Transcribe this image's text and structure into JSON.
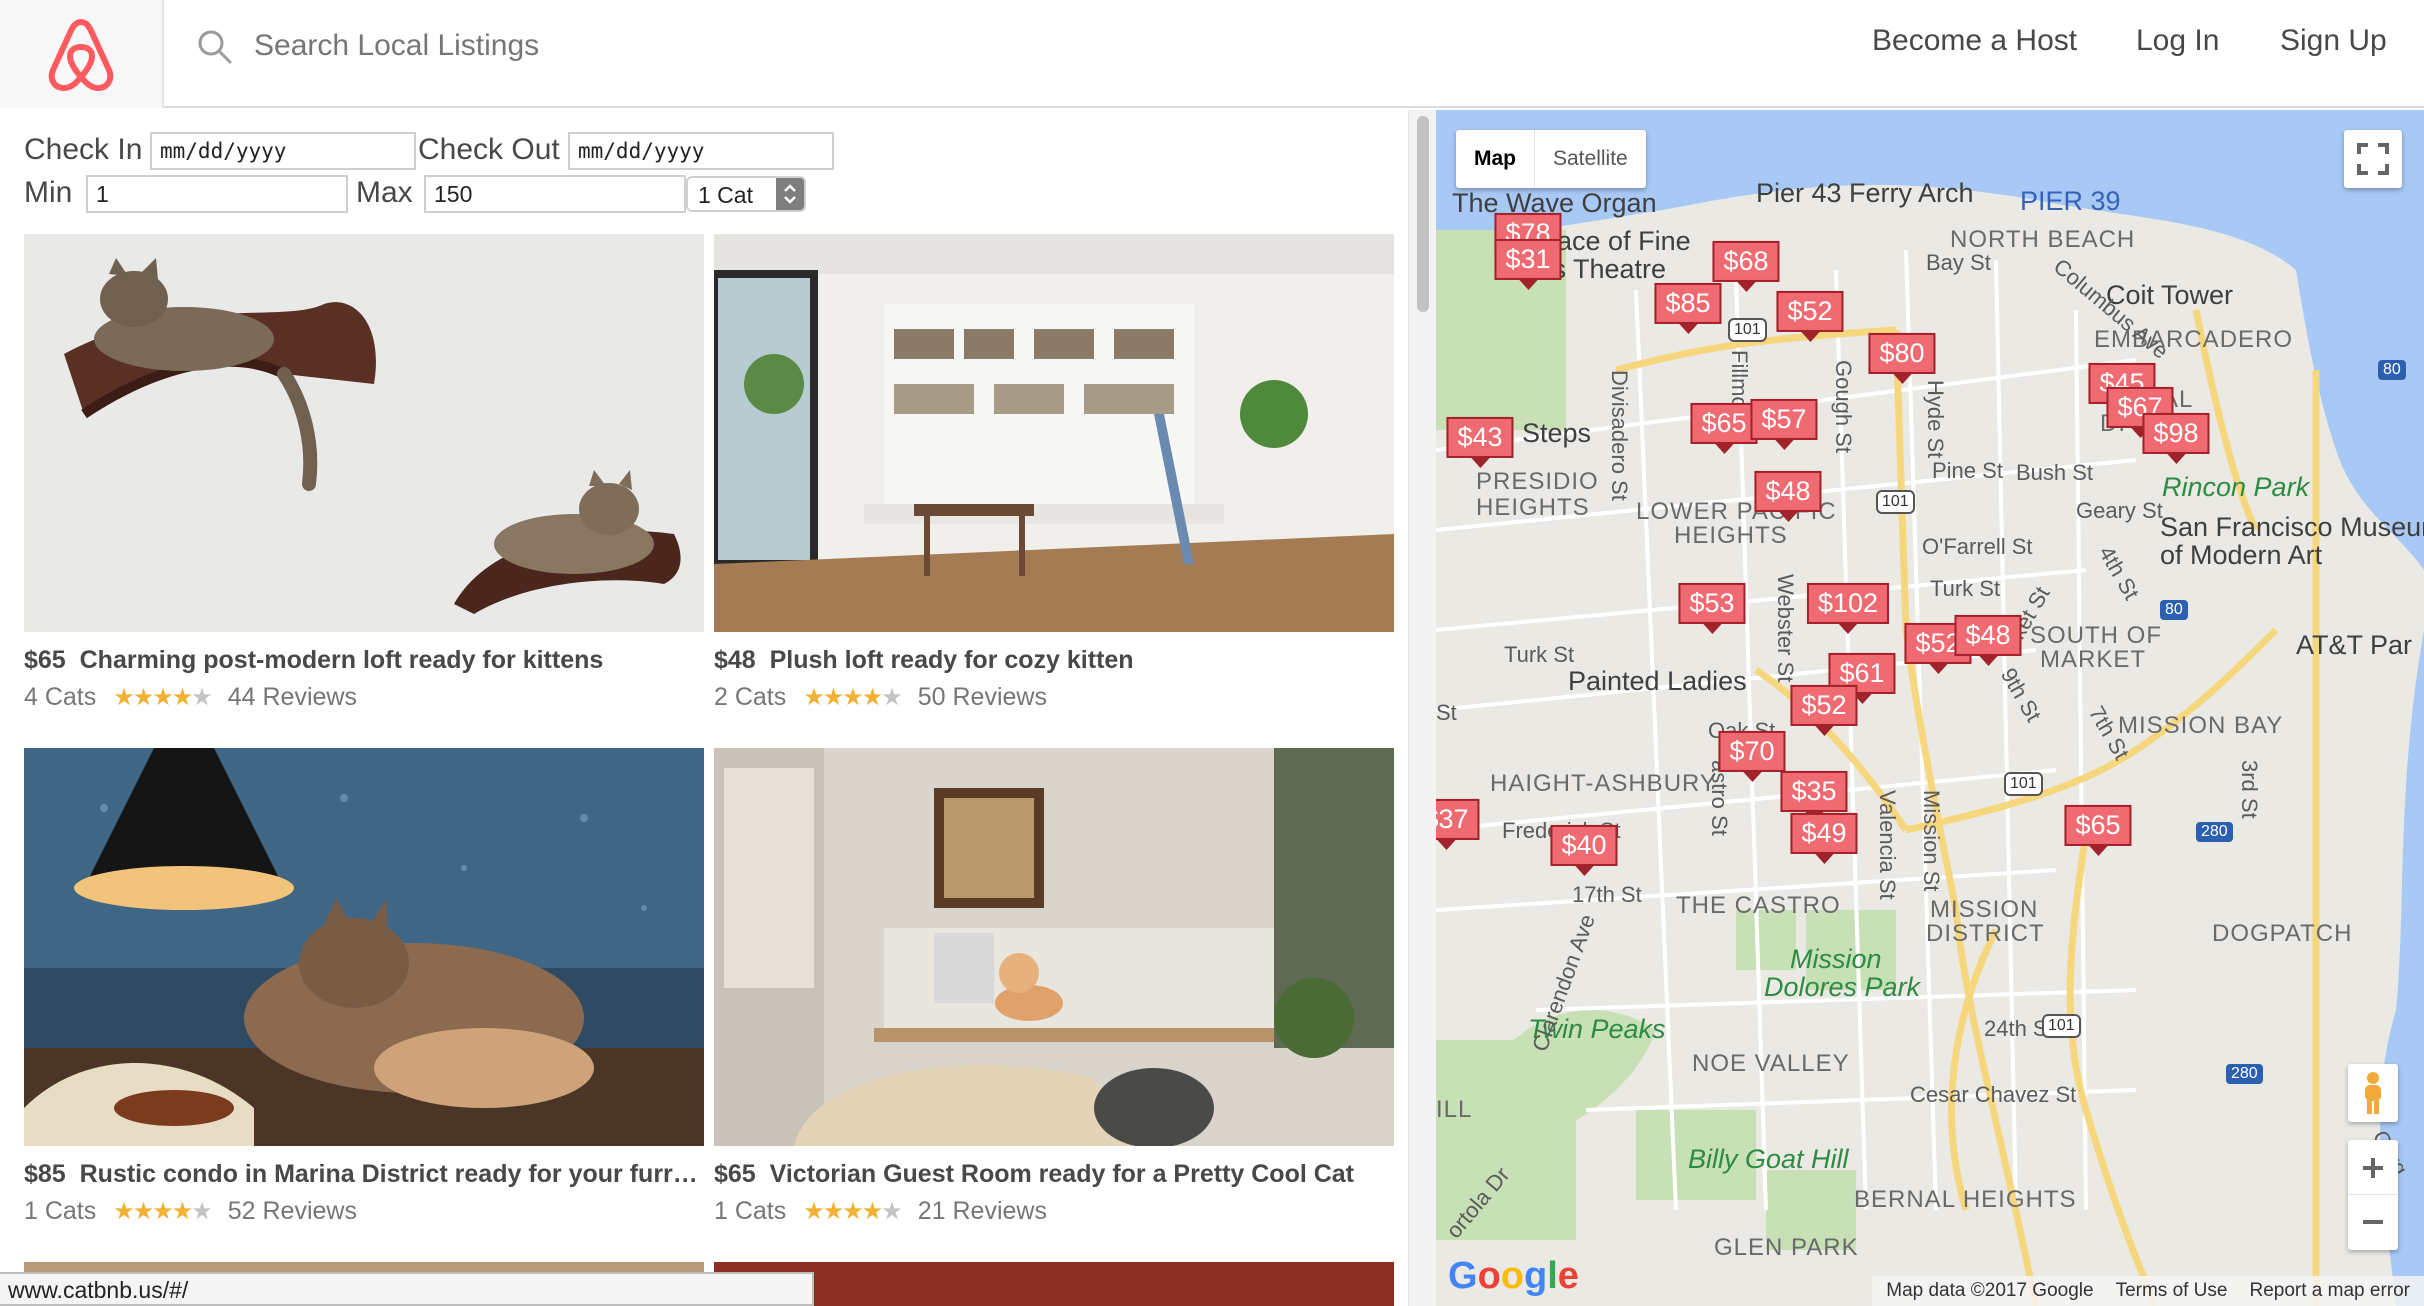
{
  "header": {
    "search_placeholder": "Search Local Listings",
    "nav": [
      "Become a Host",
      "Log In",
      "Sign Up"
    ]
  },
  "filters": {
    "check_in_label": "Check In",
    "check_in_value": "mm/dd/yyyy",
    "check_out_label": "Check Out",
    "check_out_value": "mm/dd/yyyy",
    "min_label": "Min",
    "min_value": "1",
    "max_label": "Max",
    "max_value": "150",
    "cats_select": "1 Cat"
  },
  "listings": [
    {
      "price": "$65",
      "title": "Charming post-modern loft ready for kittens",
      "cats": "4 Cats",
      "rating": 4,
      "reviews": "44 Reviews"
    },
    {
      "price": "$48",
      "title": "Plush loft ready for cozy kitten",
      "cats": "2 Cats",
      "rating": 4.5,
      "reviews": "50 Reviews"
    },
    {
      "price": "$85",
      "title": "Rustic condo in Marina District ready for your furry f...",
      "cats": "1 Cats",
      "rating": 4,
      "reviews": "52 Reviews"
    },
    {
      "price": "$65",
      "title": "Victorian Guest Room ready for a Pretty Cool Cat",
      "cats": "1 Cats",
      "rating": 4.5,
      "reviews": "21 Reviews"
    }
  ],
  "status_url": "www.catbnb.us/#/",
  "map": {
    "type_buttons": [
      "Map",
      "Satellite"
    ],
    "pins": [
      "$78",
      "$31",
      "$68",
      "$85",
      "$52",
      "$80",
      "$45",
      "$67",
      "$98",
      "$65",
      "$57",
      "$43",
      "$48",
      "$53",
      "$102",
      "$52",
      "$48",
      "$61",
      "$52",
      "$70",
      "$35",
      "$49",
      "$40",
      "$37",
      "$65"
    ],
    "labels": {
      "wave_organ": "The Wave Organ",
      "pier43": "Pier 43 Ferry Arch",
      "pier39": "PIER 39",
      "palace": "Palace of Fine",
      "arts": "Arts Theatre",
      "north_beach": "NORTH BEACH",
      "coit": "Coit Tower",
      "embarcadero": "EMBARCADERO",
      "steps": "Steps",
      "presidio": "PRESIDIO",
      "heights": "HEIGHTS",
      "lower_pac": "LOWER PACIFIC",
      "lower_pac2": "HEIGHTS",
      "rincon": "Rincon Park",
      "sfmoma": "San Francisco Museum",
      "sfmoma2": "of Modern Art",
      "painted": "Painted Ladies",
      "soma": "SOUTH OF",
      "soma2": "MARKET",
      "att": "AT&T Par",
      "mission_bay": "MISSION BAY",
      "haight": "HAIGHT-ASHBURY",
      "castro": "THE CASTRO",
      "mission": "MISSION",
      "mission2": "DISTRICT",
      "dolores": "Mission",
      "dolores2": "Dolores Park",
      "dogpatch": "DOGPATCH",
      "twin": "Twin Peaks",
      "noe": "NOE VALLEY",
      "billy": "Billy Goat Hill",
      "bernal": "BERNAL HEIGHTS",
      "glen": "GLEN PARK",
      "turk": "Turk St",
      "oak": "Oak St",
      "pine": "Pine St",
      "bush": "Bush St",
      "geary": "Geary St",
      "ofarrell": "O'Farrell St",
      "turk2": "Turk St",
      "frederick": "Frederick St",
      "s17": "17th St",
      "s24": "24th St",
      "cesar": "Cesar Chavez St",
      "bay": "Bay St",
      "columbus": "Columbus Ave",
      "divisadero": "Divisadero St",
      "fillmore": "Fillmore",
      "gough": "Gough St",
      "hyde": "Hyde St",
      "webster": "Webster St",
      "valencia": "Valencia St",
      "mission_st": "Mission St",
      "clarendon": "Clarendon Ave",
      "s4th": "4th St",
      "s7th": "7th St",
      "s9th": "9th St",
      "s3rd": "3rd St",
      "ket": "ket St",
      "castro_st": "astro St",
      "ortola": "ortola Dr",
      "carg": "Carg",
      "ill": "ILL",
      "st_left": "St",
      "cial": "CIAL",
      "di": "DI",
      "r80": "80",
      "r80b": "80",
      "r101": "101",
      "r101b": "101",
      "r101c": "101",
      "r101d": "101",
      "r280": "280",
      "r280b": "280"
    },
    "google": "Google",
    "footer": [
      "Map data ©2017 Google",
      "Terms of Use",
      "Report a map error"
    ]
  }
}
